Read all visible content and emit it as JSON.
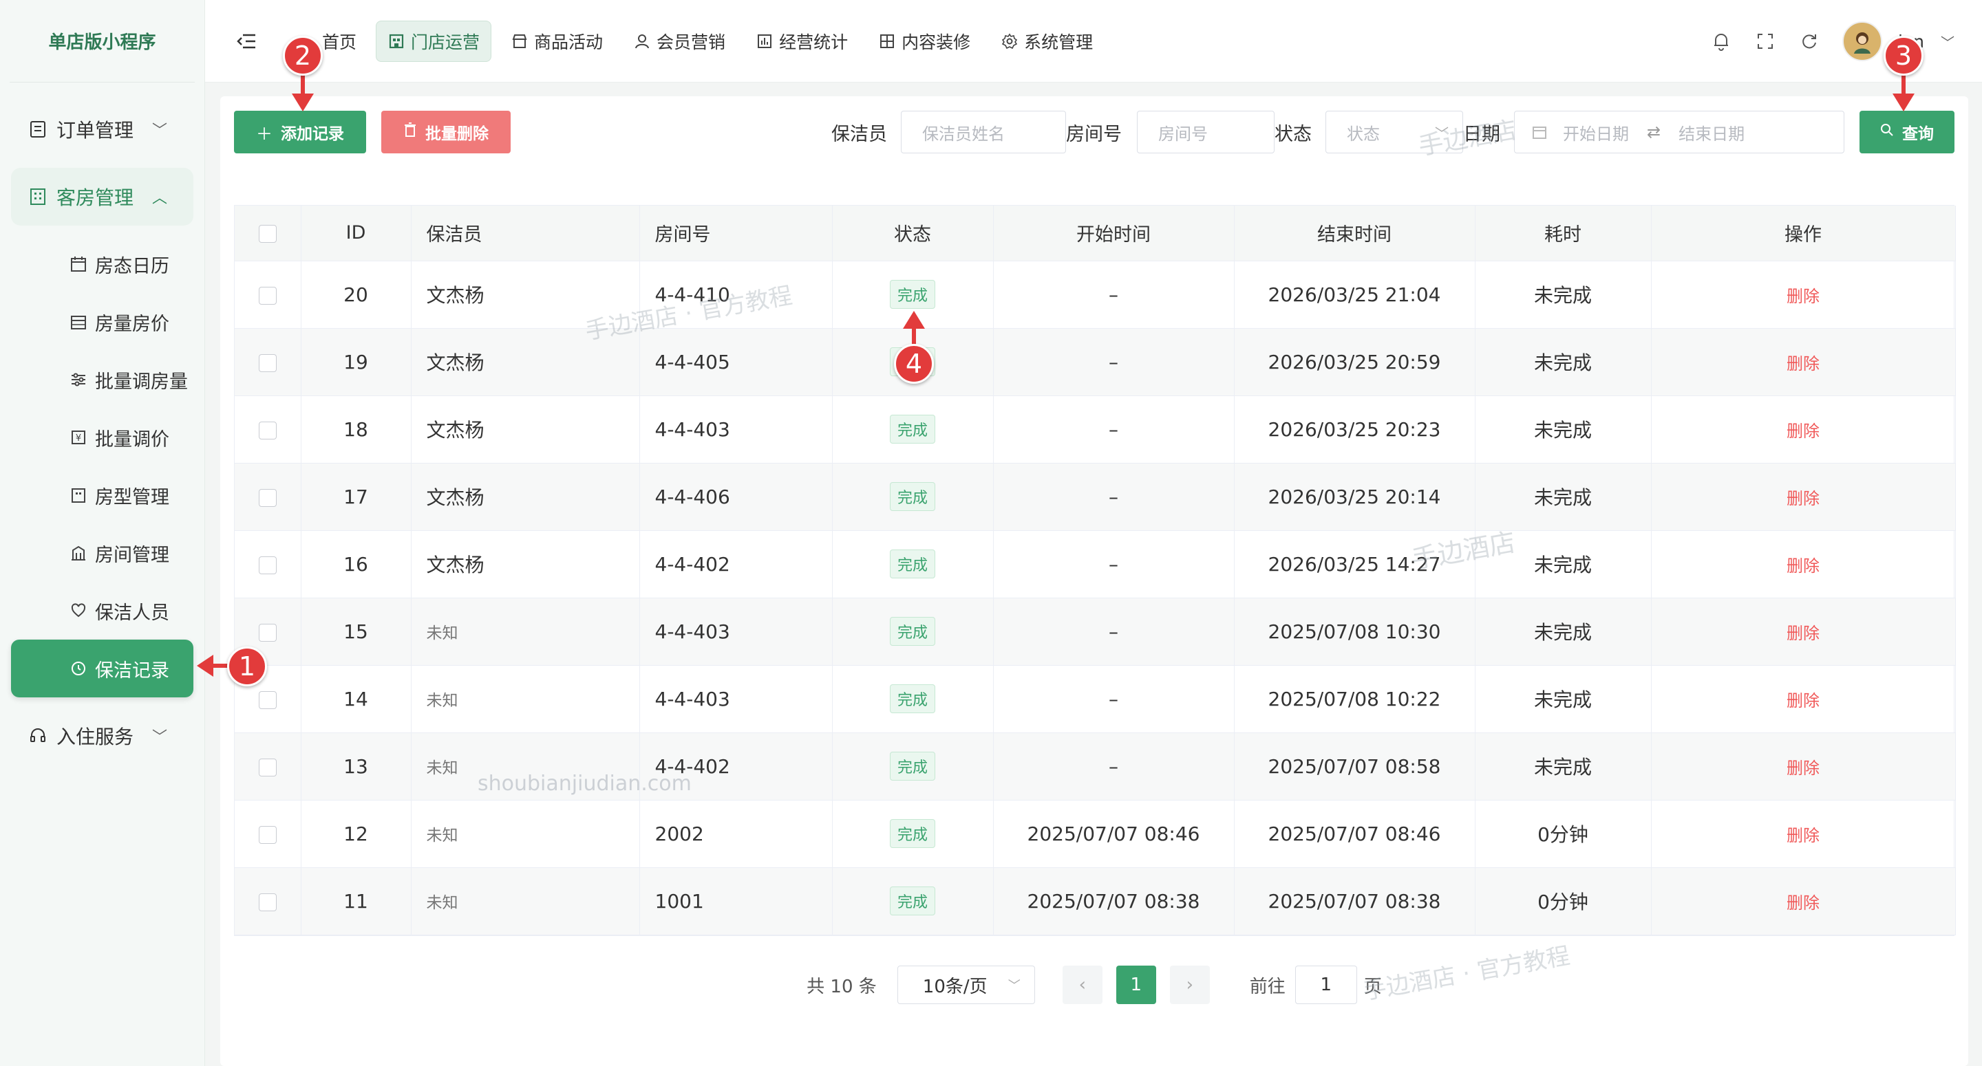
{
  "app": {
    "brand": "单店版小程序"
  },
  "sidebar": {
    "groups": [
      {
        "label": "订单管理"
      },
      {
        "label": "客房管理"
      },
      {
        "label": "入住服务"
      }
    ],
    "subitems": [
      {
        "label": "房态日历",
        "icon": "calendar-icon"
      },
      {
        "label": "房量房价",
        "icon": "calendar-grid-icon"
      },
      {
        "label": "批量调房量",
        "icon": "sliders-icon"
      },
      {
        "label": "批量调价",
        "icon": "price-tag-icon"
      },
      {
        "label": "房型管理",
        "icon": "room-type-icon"
      },
      {
        "label": "房间管理",
        "icon": "building-icon"
      },
      {
        "label": "保洁人员",
        "icon": "heart-hand-icon"
      },
      {
        "label": "保洁记录",
        "icon": "history-icon"
      }
    ]
  },
  "header": {
    "nav": [
      {
        "label": "首页",
        "icon": "home-icon"
      },
      {
        "label": "门店运营",
        "icon": "store-icon"
      },
      {
        "label": "商品活动",
        "icon": "shop-icon"
      },
      {
        "label": "会员营销",
        "icon": "user-icon"
      },
      {
        "label": "经营统计",
        "icon": "bar-chart-icon"
      },
      {
        "label": "内容装修",
        "icon": "layout-icon"
      },
      {
        "label": "系统管理",
        "icon": "gear-icon"
      }
    ],
    "username": "dan"
  },
  "toolbar": {
    "add_label": "添加记录",
    "batch_delete_label": "批量删除",
    "filter_cleaner_label": "保洁员",
    "filter_cleaner_placeholder": "保洁员姓名",
    "filter_room_label": "房间号",
    "filter_room_placeholder": "房间号",
    "filter_status_label": "状态",
    "filter_status_placeholder": "状态",
    "filter_date_label": "日期",
    "date_start_placeholder": "开始日期",
    "date_end_placeholder": "结束日期",
    "query_label": "查询"
  },
  "table": {
    "columns": [
      "ID",
      "保洁员",
      "房间号",
      "状态",
      "开始时间",
      "结束时间",
      "耗时",
      "操作"
    ],
    "rows": [
      {
        "id": "20",
        "cleaner": "文杰杨",
        "room": "4-4-410",
        "status": "完成",
        "start": "–",
        "end": "2026/03/25 21:04",
        "duration": "未完成",
        "action": "删除"
      },
      {
        "id": "19",
        "cleaner": "文杰杨",
        "room": "4-4-405",
        "status": "完成",
        "start": "–",
        "end": "2026/03/25 20:59",
        "duration": "未完成",
        "action": "删除"
      },
      {
        "id": "18",
        "cleaner": "文杰杨",
        "room": "4-4-403",
        "status": "完成",
        "start": "–",
        "end": "2026/03/25 20:23",
        "duration": "未完成",
        "action": "删除"
      },
      {
        "id": "17",
        "cleaner": "文杰杨",
        "room": "4-4-406",
        "status": "完成",
        "start": "–",
        "end": "2026/03/25 20:14",
        "duration": "未完成",
        "action": "删除"
      },
      {
        "id": "16",
        "cleaner": "文杰杨",
        "room": "4-4-402",
        "status": "完成",
        "start": "–",
        "end": "2026/03/25 14:27",
        "duration": "未完成",
        "action": "删除"
      },
      {
        "id": "15",
        "cleaner": "未知",
        "room": "4-4-403",
        "status": "完成",
        "start": "–",
        "end": "2025/07/08 10:30",
        "duration": "未完成",
        "action": "删除"
      },
      {
        "id": "14",
        "cleaner": "未知",
        "room": "4-4-403",
        "status": "完成",
        "start": "–",
        "end": "2025/07/08 10:22",
        "duration": "未完成",
        "action": "删除"
      },
      {
        "id": "13",
        "cleaner": "未知",
        "room": "4-4-402",
        "status": "完成",
        "start": "–",
        "end": "2025/07/07 08:58",
        "duration": "未完成",
        "action": "删除"
      },
      {
        "id": "12",
        "cleaner": "未知",
        "room": "2002",
        "status": "完成",
        "start": "2025/07/07 08:46",
        "end": "2025/07/07 08:46",
        "duration": "0分钟",
        "action": "删除"
      },
      {
        "id": "11",
        "cleaner": "未知",
        "room": "1001",
        "status": "完成",
        "start": "2025/07/07 08:38",
        "end": "2025/07/07 08:38",
        "duration": "0分钟",
        "action": "删除"
      }
    ]
  },
  "pagination": {
    "total": "共 10 条",
    "page_size": "10条/页",
    "current_page": "1",
    "goto_prefix": "前往",
    "goto_value": "1",
    "goto_suffix": "页"
  },
  "annotations": [
    "1",
    "2",
    "3",
    "4"
  ],
  "watermarks": [
    "手边酒店 · 官方教程",
    "手边酒店",
    "shoubianjiudian.com",
    "手边酒店 · 官方教程",
    "手边酒店"
  ],
  "colors": {
    "primary": "#3aa36e",
    "danger": "#f07a7a",
    "callout": "#e23b3b"
  }
}
